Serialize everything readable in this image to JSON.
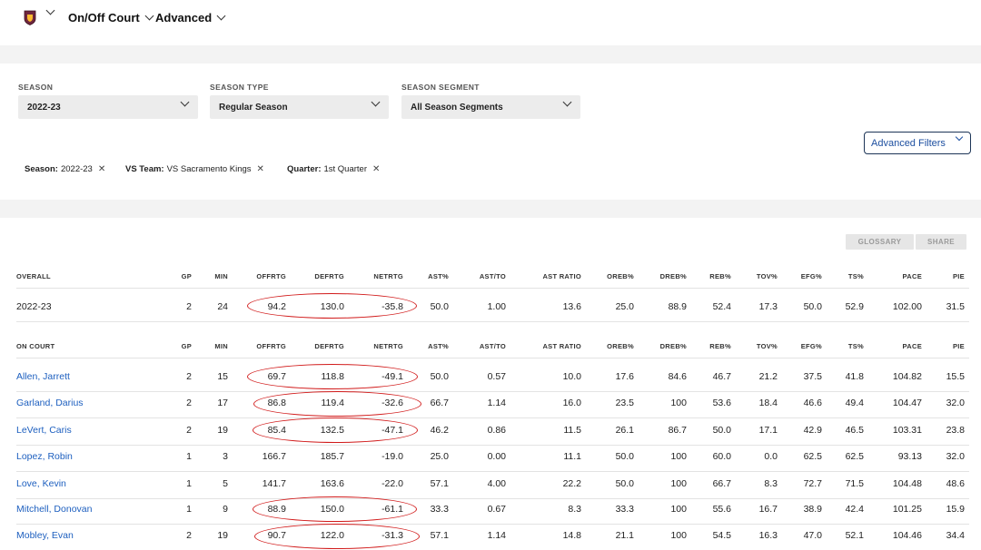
{
  "nav": {
    "team_logo": "cavaliers-logo",
    "menu1": "On/Off Court",
    "menu2": "Advanced"
  },
  "filters": {
    "season": {
      "label": "SEASON",
      "value": "2022-23"
    },
    "season_type": {
      "label": "SEASON TYPE",
      "value": "Regular Season"
    },
    "season_segment": {
      "label": "SEASON SEGMENT",
      "value": "All Season Segments"
    },
    "advanced_filters": "Advanced Filters"
  },
  "chips": [
    {
      "key": "Season:",
      "value": "2022-23"
    },
    {
      "key": "VS Team:",
      "value": "VS Sacramento Kings"
    },
    {
      "key": "Quarter:",
      "value": "1st Quarter"
    }
  ],
  "buttons": {
    "glossary": "GLOSSARY",
    "share": "SHARE"
  },
  "columns": [
    "GP",
    "MIN",
    "OFFRTG",
    "DEFRTG",
    "NETRTG",
    "AST%",
    "AST/TO",
    "AST RATIO",
    "OREB%",
    "DREB%",
    "REB%",
    "TOV%",
    "EFG%",
    "TS%",
    "PACE",
    "PIE"
  ],
  "overall": {
    "header": "OVERALL",
    "row": {
      "label": "2022-23",
      "values": [
        "2",
        "24",
        "94.2",
        "130.0",
        "-35.8",
        "50.0",
        "1.00",
        "13.6",
        "25.0",
        "88.9",
        "52.4",
        "17.3",
        "50.0",
        "52.9",
        "102.00",
        "31.5"
      ]
    }
  },
  "on_court": {
    "header": "ON COURT",
    "rows": [
      {
        "name": "Allen, Jarrett",
        "values": [
          "2",
          "15",
          "69.7",
          "118.8",
          "-49.1",
          "50.0",
          "0.57",
          "10.0",
          "17.6",
          "84.6",
          "46.7",
          "21.2",
          "37.5",
          "41.8",
          "104.82",
          "15.5"
        ]
      },
      {
        "name": "Garland, Darius",
        "values": [
          "2",
          "17",
          "86.8",
          "119.4",
          "-32.6",
          "66.7",
          "1.14",
          "16.0",
          "23.5",
          "100",
          "53.6",
          "18.4",
          "46.6",
          "49.4",
          "104.47",
          "32.0"
        ]
      },
      {
        "name": "LeVert, Caris",
        "values": [
          "2",
          "19",
          "85.4",
          "132.5",
          "-47.1",
          "46.2",
          "0.86",
          "11.5",
          "26.1",
          "86.7",
          "50.0",
          "17.1",
          "42.9",
          "46.5",
          "103.31",
          "23.8"
        ]
      },
      {
        "name": "Lopez, Robin",
        "values": [
          "1",
          "3",
          "166.7",
          "185.7",
          "-19.0",
          "25.0",
          "0.00",
          "11.1",
          "50.0",
          "100",
          "60.0",
          "0.0",
          "62.5",
          "62.5",
          "93.13",
          "32.0"
        ]
      },
      {
        "name": "Love, Kevin",
        "values": [
          "1",
          "5",
          "141.7",
          "163.6",
          "-22.0",
          "57.1",
          "4.00",
          "22.2",
          "50.0",
          "100",
          "66.7",
          "8.3",
          "72.7",
          "71.5",
          "104.48",
          "48.6"
        ]
      },
      {
        "name": "Mitchell, Donovan",
        "values": [
          "1",
          "9",
          "88.9",
          "150.0",
          "-61.1",
          "33.3",
          "0.67",
          "8.3",
          "33.3",
          "100",
          "55.6",
          "16.7",
          "38.9",
          "42.4",
          "101.25",
          "15.9"
        ]
      },
      {
        "name": "Mobley, Evan",
        "values": [
          "2",
          "19",
          "90.7",
          "122.0",
          "-31.3",
          "57.1",
          "1.14",
          "14.8",
          "21.1",
          "100",
          "54.5",
          "16.3",
          "47.0",
          "52.1",
          "104.46",
          "34.4"
        ]
      }
    ]
  },
  "highlight_color": "#d11a1a",
  "link_color": "#1d5fbf"
}
